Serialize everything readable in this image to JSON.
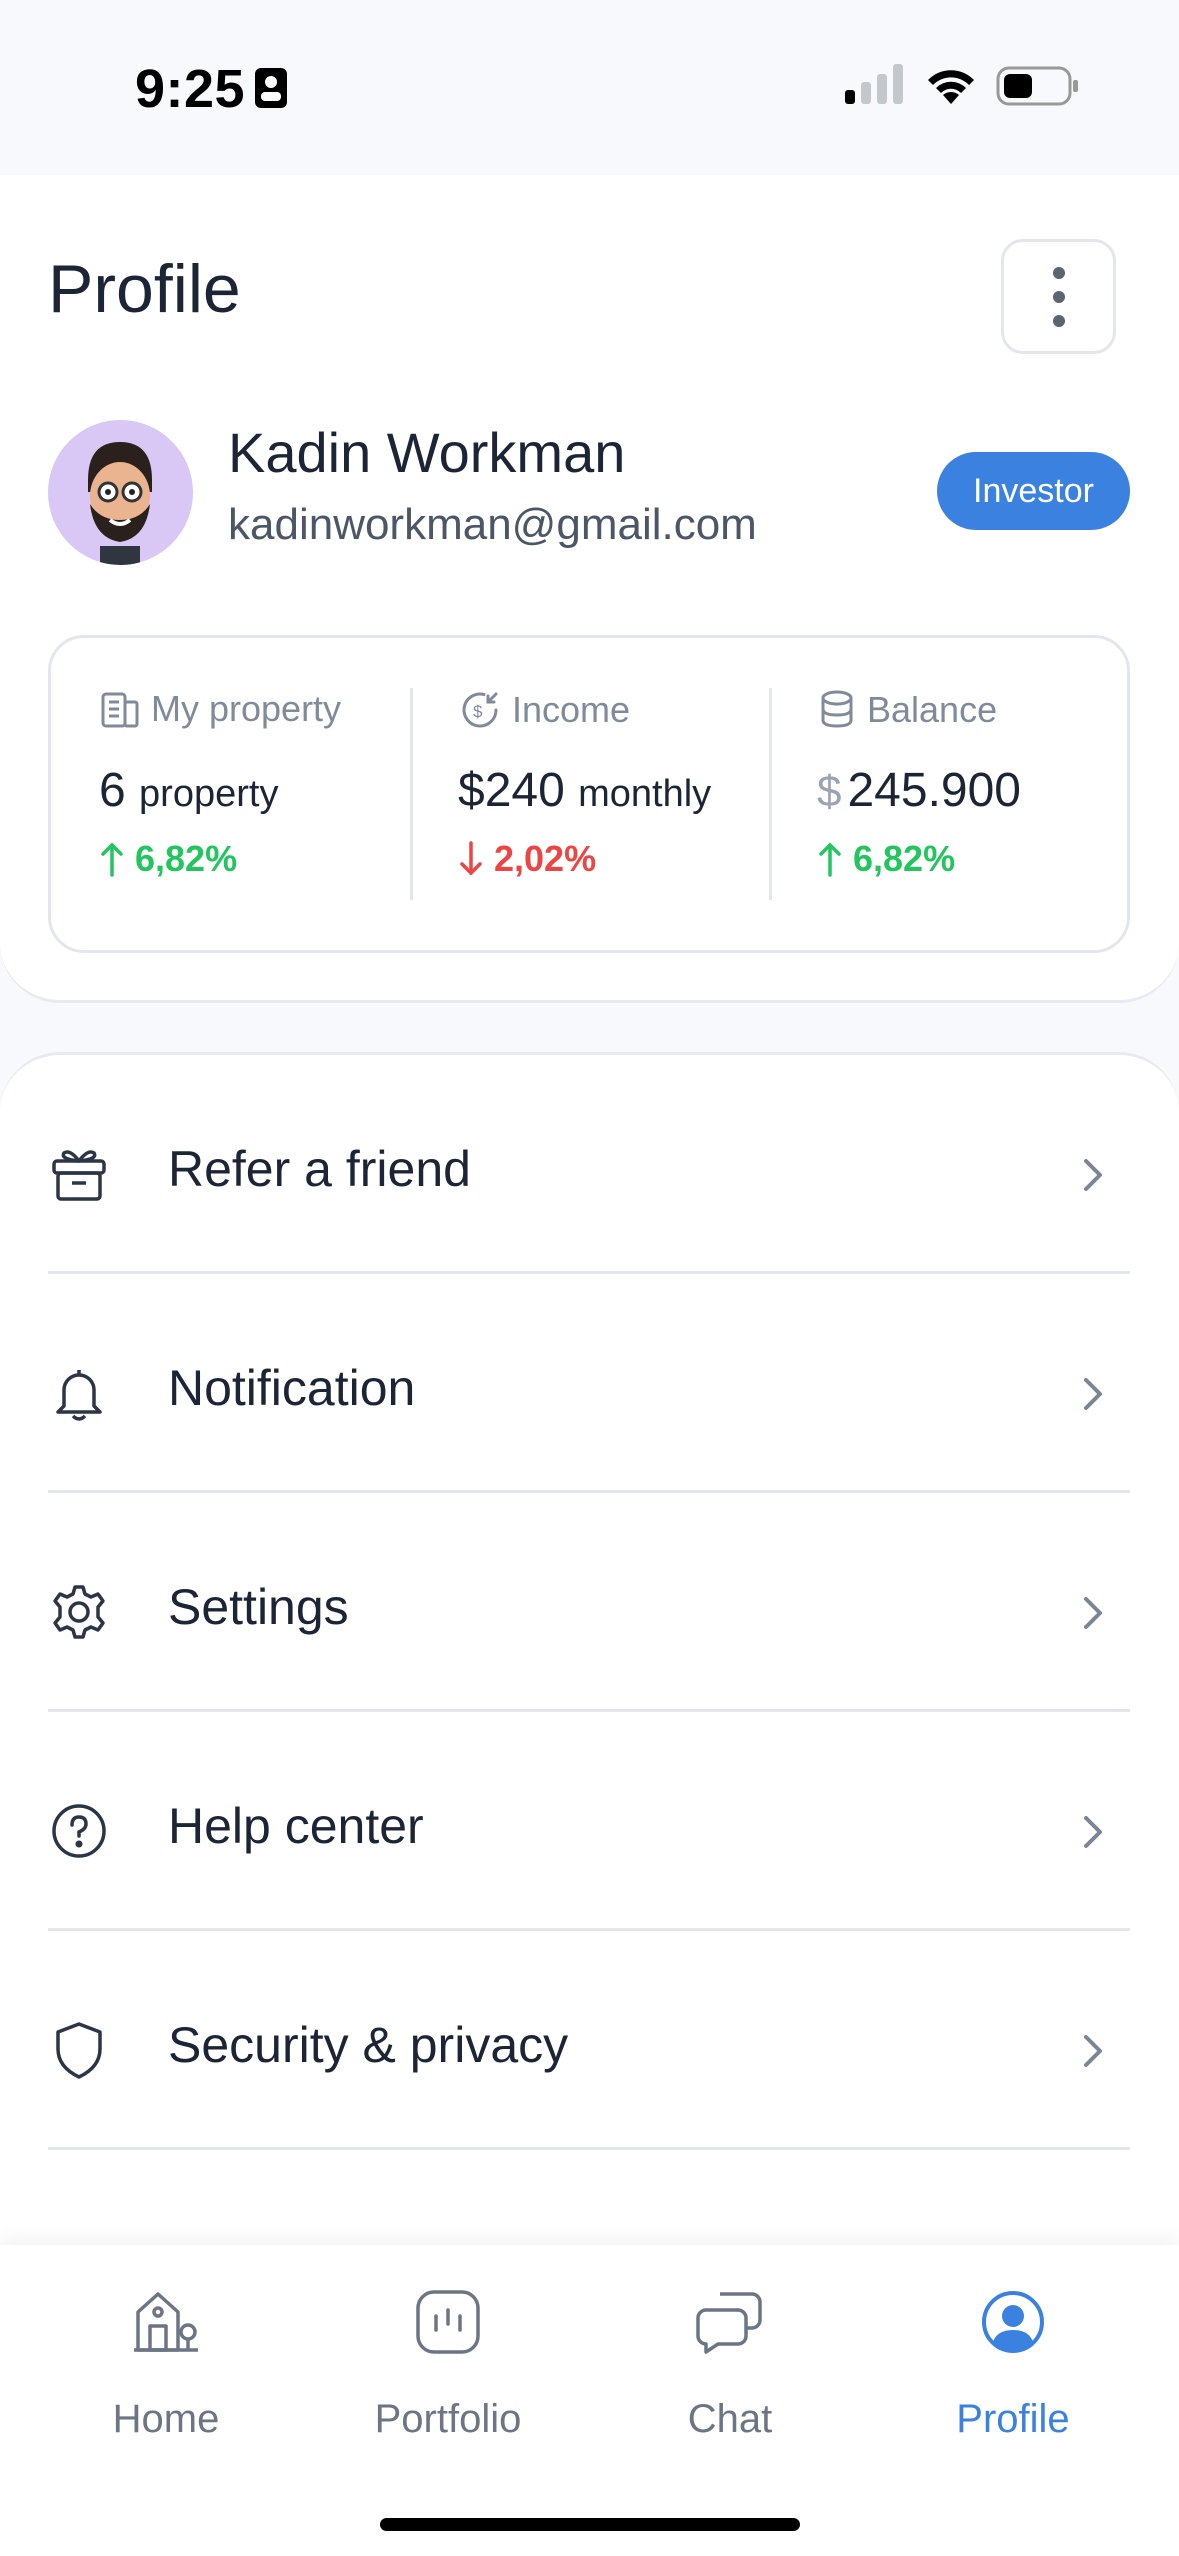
{
  "status_bar": {
    "time": "9:25"
  },
  "header": {
    "title": "Profile"
  },
  "user": {
    "name": "Kadin Workman",
    "email": "kadinworkman@gmail.com",
    "role": "Investor"
  },
  "stats": [
    {
      "label": "My property",
      "icon": "building-icon",
      "value": "6",
      "unit": "property",
      "change": "6,82%",
      "direction": "up"
    },
    {
      "label": "Income",
      "icon": "income-icon",
      "value": "$240",
      "unit": "monthly",
      "change": "2,02%",
      "direction": "down"
    },
    {
      "label": "Balance",
      "icon": "coins-icon",
      "currency": "$",
      "value": "245.900",
      "change": "6,82%",
      "direction": "up"
    }
  ],
  "menu": [
    {
      "label": "Refer a friend",
      "icon": "gift-icon"
    },
    {
      "label": "Notification",
      "icon": "bell-icon"
    },
    {
      "label": "Settings",
      "icon": "gear-icon"
    },
    {
      "label": "Help center",
      "icon": "help-icon"
    },
    {
      "label": "Security & privacy",
      "icon": "shield-icon"
    }
  ],
  "tabs": [
    {
      "label": "Home",
      "icon": "home-icon",
      "active": false
    },
    {
      "label": "Portfolio",
      "icon": "portfolio-icon",
      "active": false
    },
    {
      "label": "Chat",
      "icon": "chat-icon",
      "active": false
    },
    {
      "label": "Profile",
      "icon": "user-icon",
      "active": true
    }
  ],
  "colors": {
    "accent": "#3b82e0",
    "positive": "#22c55e",
    "negative": "#ef4444",
    "avatar_bg": "#d9c8f5"
  }
}
